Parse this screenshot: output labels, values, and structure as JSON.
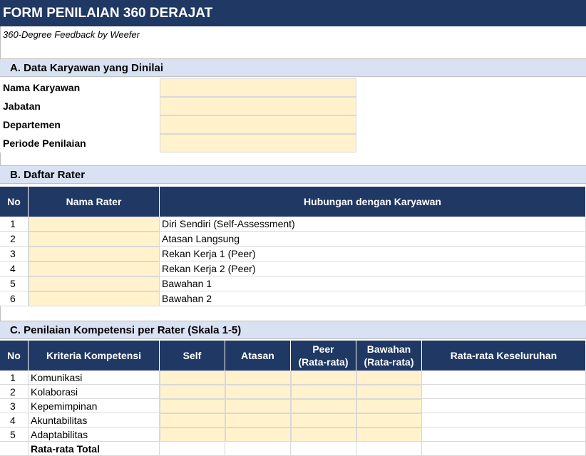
{
  "header": {
    "title": "FORM PENILAIAN 360 DERAJAT",
    "subtitle": "360-Degree Feedback by Weefer"
  },
  "section_a": {
    "title": "A. Data Karyawan yang Dinilai",
    "fields": [
      {
        "label": "Nama Karyawan",
        "value": ""
      },
      {
        "label": "Jabatan",
        "value": ""
      },
      {
        "label": "Departemen",
        "value": ""
      },
      {
        "label": "Periode Penilaian",
        "value": ""
      }
    ]
  },
  "section_b": {
    "title": "B. Daftar Rater",
    "columns": [
      "No",
      "Nama Rater",
      "Hubungan dengan Karyawan"
    ],
    "rows": [
      {
        "no": "1",
        "name": "",
        "relation": "Diri Sendiri (Self-Assessment)"
      },
      {
        "no": "2",
        "name": "",
        "relation": "Atasan Langsung"
      },
      {
        "no": "3",
        "name": "",
        "relation": "Rekan Kerja 1 (Peer)"
      },
      {
        "no": "4",
        "name": "",
        "relation": "Rekan Kerja 2 (Peer)"
      },
      {
        "no": "5",
        "name": "",
        "relation": "Bawahan 1"
      },
      {
        "no": "6",
        "name": "",
        "relation": "Bawahan 2"
      }
    ]
  },
  "section_c": {
    "title": "C. Penilaian Kompetensi per Rater (Skala 1-5)",
    "columns": [
      "No",
      "Kriteria Kompetensi",
      "Self",
      "Atasan",
      "Peer (Rata-rata)",
      "Bawahan (Rata-rata)",
      "Rata-rata Keseluruhan"
    ],
    "rows": [
      {
        "no": "1",
        "criteria": "Komunikasi"
      },
      {
        "no": "2",
        "criteria": "Kolaborasi"
      },
      {
        "no": "3",
        "criteria": "Kepemimpinan"
      },
      {
        "no": "4",
        "criteria": "Akuntabilitas"
      },
      {
        "no": "5",
        "criteria": "Adaptabilitas"
      }
    ],
    "total_label": "Rata-rata Total"
  },
  "colors": {
    "header_bg": "#1f3864",
    "section_bg": "#d9e2f3",
    "input_bg": "#fff2cc"
  }
}
